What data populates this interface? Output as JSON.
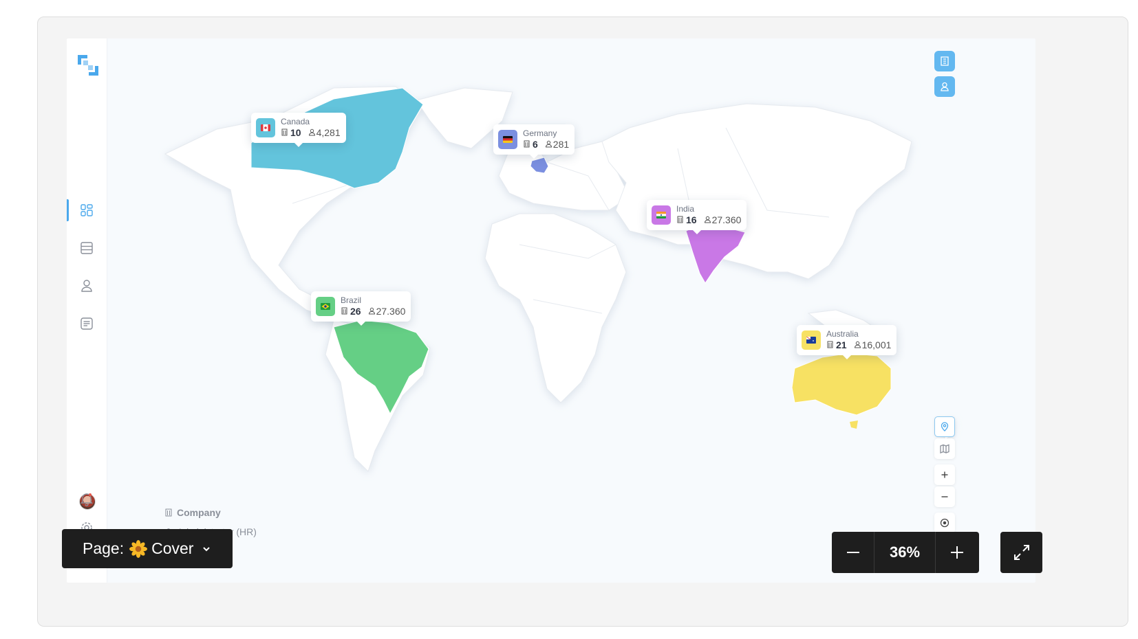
{
  "sidebar": {
    "items": [
      {
        "icon": "dashboard-icon",
        "active": true
      },
      {
        "icon": "database-icon",
        "active": false
      },
      {
        "icon": "user-icon",
        "active": false
      },
      {
        "icon": "message-icon",
        "active": false
      }
    ],
    "bottom": [
      "avatar",
      "bell-icon",
      "settings-icon"
    ]
  },
  "map": {
    "countries": [
      {
        "name": "Canada",
        "companies": "10",
        "employees": "4,281",
        "color": "#63c4dc"
      },
      {
        "name": "Germany",
        "companies": "6",
        "employees": "281",
        "color": "#7b8fe0"
      },
      {
        "name": "India",
        "companies": "16",
        "employees": "27.360",
        "color": "#c978e6"
      },
      {
        "name": "Brazil",
        "companies": "26",
        "employees": "27.360",
        "color": "#65cf85"
      },
      {
        "name": "Australia",
        "companies": "21",
        "employees": "16,001",
        "color": "#f7e163"
      }
    ],
    "legend": {
      "company": "Company",
      "administrator": "Administrator (HR)"
    }
  },
  "colors": {
    "accent": "#63b8f0",
    "dark": "#1e1e1e"
  },
  "toolbar": {
    "page_label": "Page:",
    "page_name": "Cover",
    "zoom": "36%"
  }
}
